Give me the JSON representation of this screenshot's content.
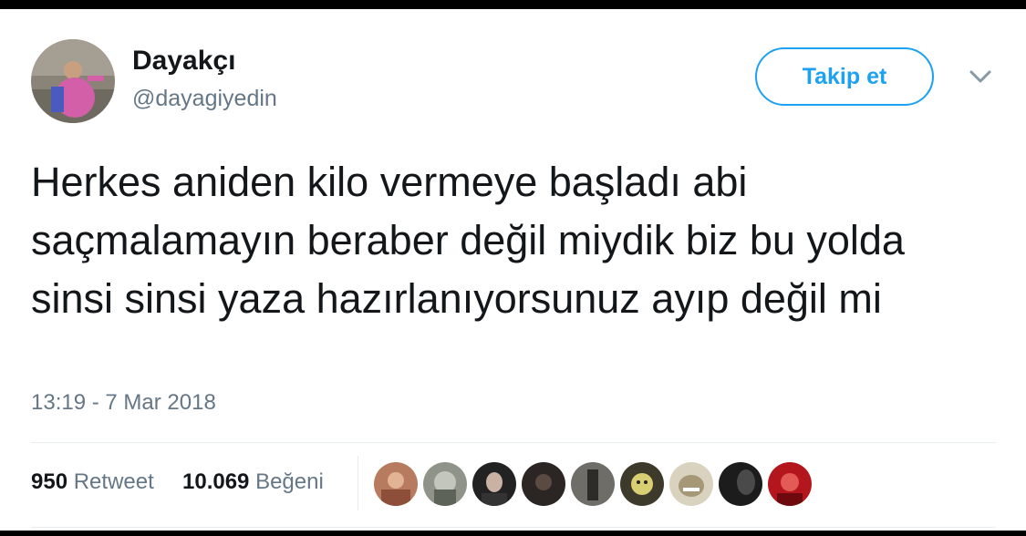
{
  "tweet": {
    "author": {
      "display_name": "Dayakçı",
      "handle": "@dayagiyedin"
    },
    "follow_label": "Takip et",
    "text": "Herkes aniden kilo vermeye başladı abi saçmalamayın beraber değil miydik biz bu yolda sinsi sinsi yaza hazırlanıyorsunuz ayıp değil mi",
    "timestamp": "13:19 - 7 Mar 2018",
    "stats": {
      "retweets": {
        "count": "950",
        "label": "Retweet"
      },
      "likes": {
        "count": "10.069",
        "label": "Beğeni"
      }
    }
  },
  "colors": {
    "accent": "#1da1f2",
    "text": "#14171a",
    "secondary": "#657786",
    "divider": "#e6ecf0"
  },
  "icons": {
    "more_menu": "chevron-down-icon"
  }
}
